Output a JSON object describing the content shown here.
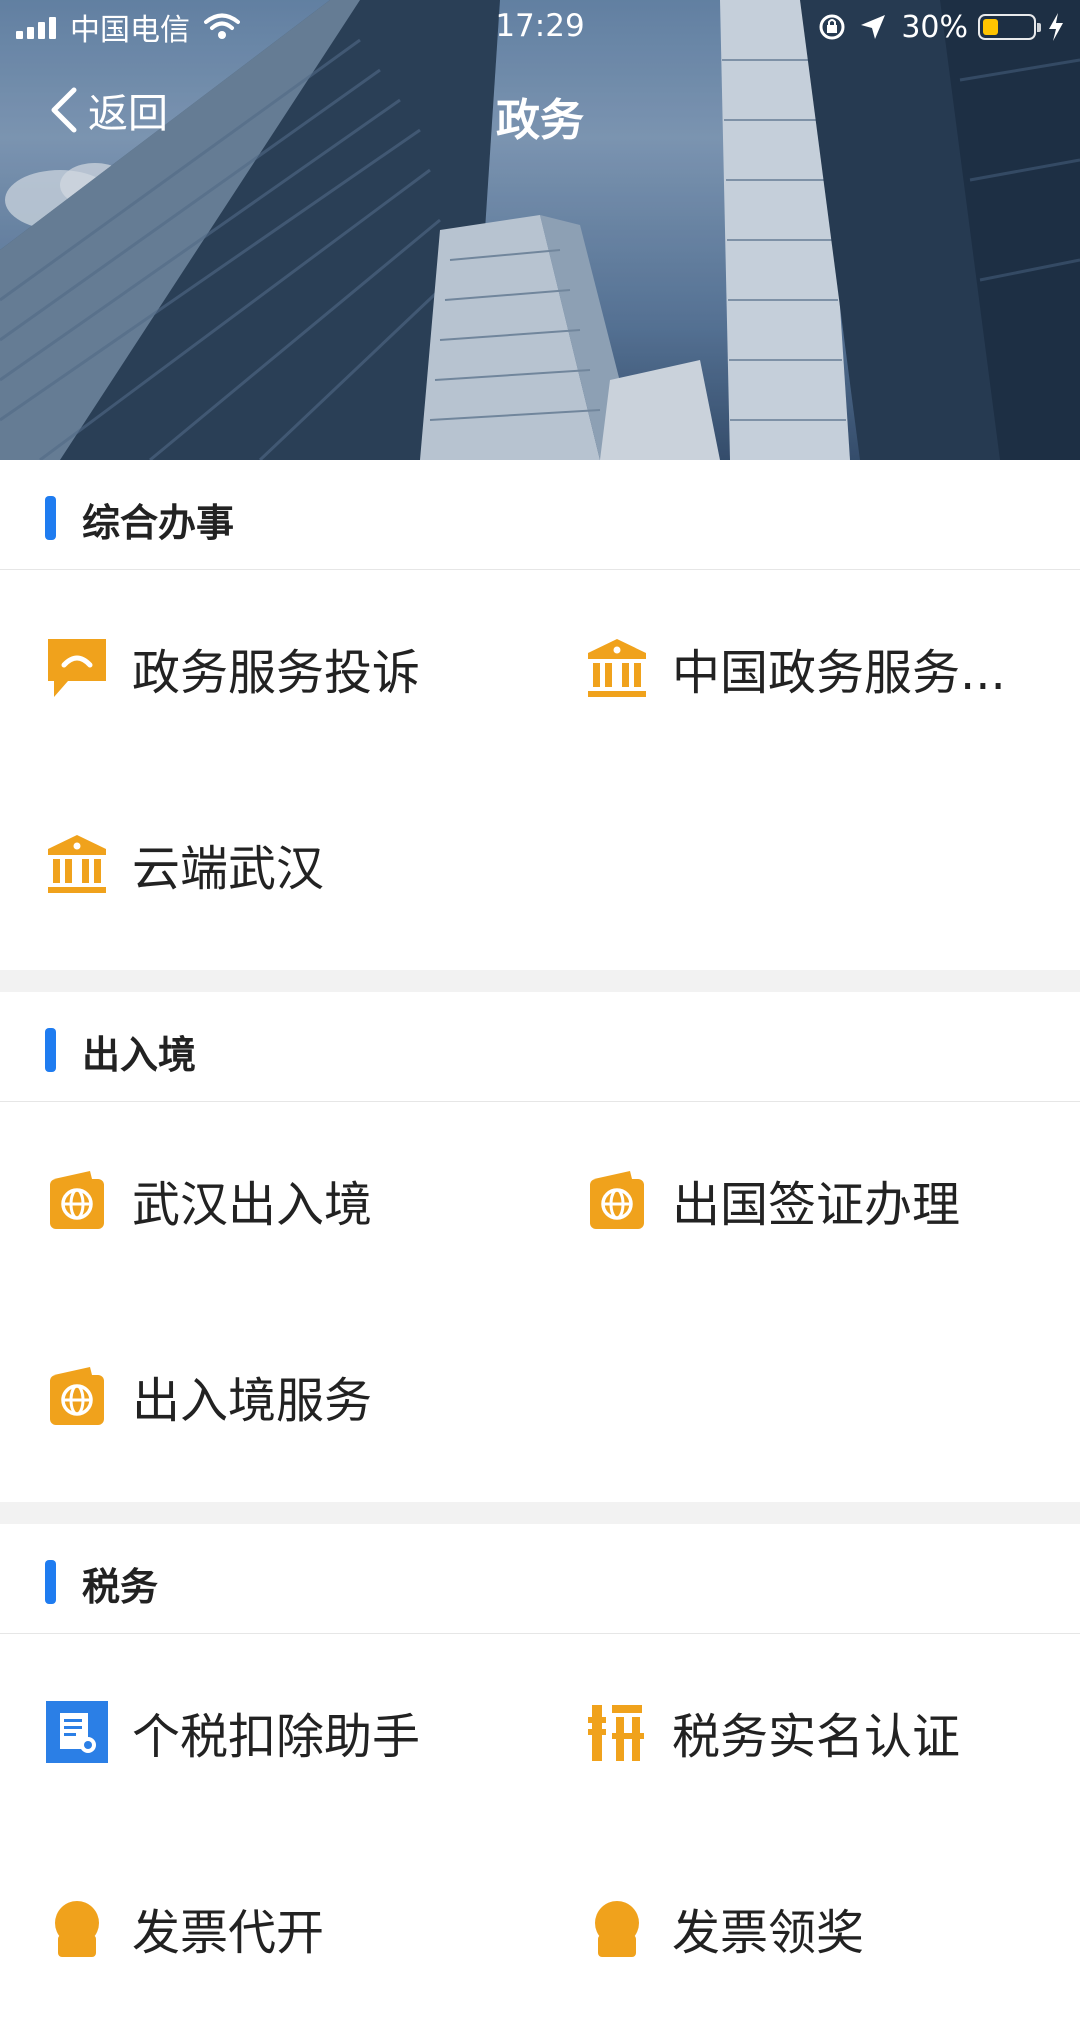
{
  "status_bar": {
    "carrier": "中国电信",
    "time": "17:29",
    "battery_percent": "30%",
    "battery_level": 0.3
  },
  "nav": {
    "back_label": "返回",
    "title": "政务"
  },
  "colors": {
    "accent_bar": "#1f7cf0",
    "icon_orange": "#f0a21c",
    "icon_blue": "#2b7fe6",
    "divider": "#f2f2f2"
  },
  "sections": [
    {
      "title": "综合办事",
      "items": [
        {
          "label": "政务服务投诉",
          "icon": "chat-bubble-icon"
        },
        {
          "label": "中国政务服务...",
          "icon": "government-building-icon"
        },
        {
          "label": "云端武汉",
          "icon": "government-building-icon"
        }
      ]
    },
    {
      "title": "出入境",
      "items": [
        {
          "label": "武汉出入境",
          "icon": "passport-icon"
        },
        {
          "label": "出国签证办理",
          "icon": "passport-icon"
        },
        {
          "label": "出入境服务",
          "icon": "passport-icon"
        }
      ]
    },
    {
      "title": "税务",
      "items": [
        {
          "label": "个税扣除助手",
          "icon": "tax-document-icon"
        },
        {
          "label": "税务实名认证",
          "icon": "tax-seal-icon"
        },
        {
          "label": "发票代开",
          "icon": "invoice-icon"
        },
        {
          "label": "发票领奖",
          "icon": "invoice-icon"
        }
      ]
    }
  ]
}
